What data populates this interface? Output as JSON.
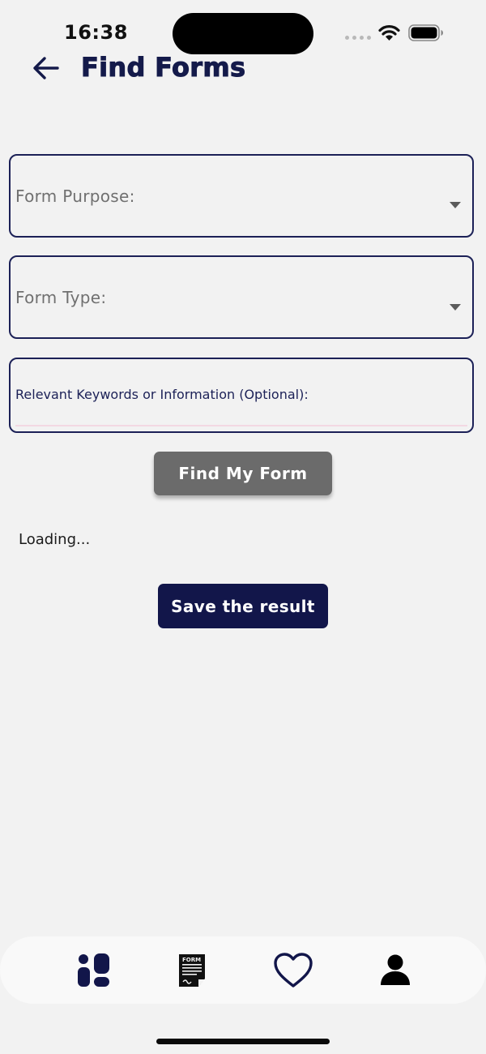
{
  "status_bar": {
    "time": "16:38"
  },
  "header": {
    "title": "Find Forms",
    "back_icon": "arrow-left-icon"
  },
  "form": {
    "purpose": {
      "label": "Form Purpose:",
      "value": ""
    },
    "type": {
      "label": "Form Type:",
      "value": ""
    },
    "keywords": {
      "label": "Relevant Keywords or Information (Optional):",
      "value": ""
    }
  },
  "actions": {
    "find_label": "Find My Form",
    "save_label": "Save the result"
  },
  "status": {
    "loading_text": "Loading..."
  },
  "bottom_nav": {
    "items": [
      {
        "icon": "dashboard-icon"
      },
      {
        "icon": "form-document-icon"
      },
      {
        "icon": "heart-icon"
      },
      {
        "icon": "user-icon"
      }
    ]
  },
  "colors": {
    "primary": "#12164a",
    "find_button": "#6b6b6b",
    "background": "#f2f2f2",
    "field_border": "#1c2157"
  }
}
